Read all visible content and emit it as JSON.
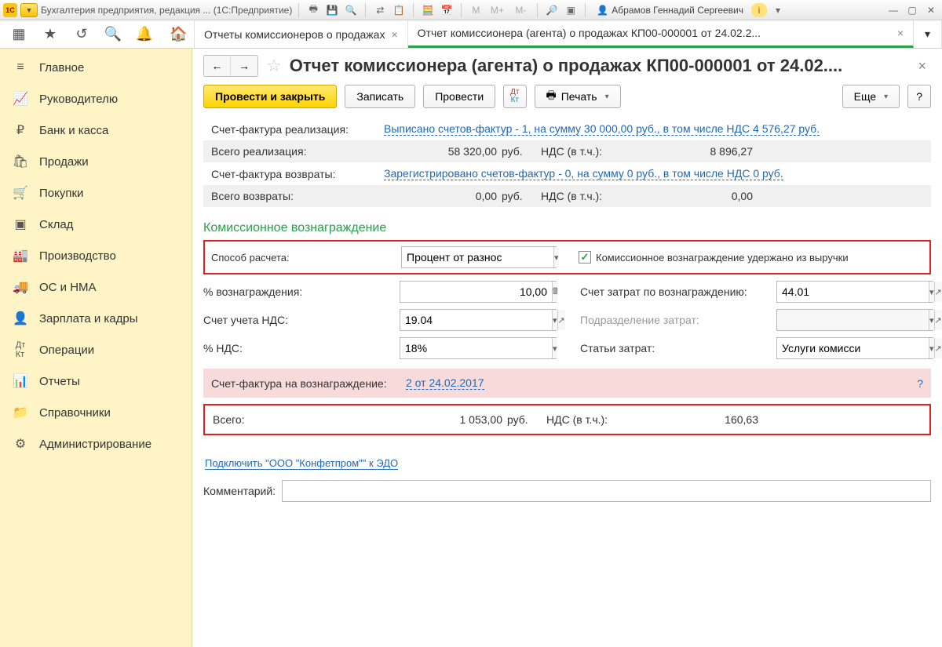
{
  "titlebar": {
    "app_title": "Бухгалтерия предприятия, редакция ... (1С:Предприятие)",
    "user": "Абрамов Геннадий Сергеевич",
    "m_lbl": "M",
    "mplus_lbl": "M+",
    "mminus_lbl": "M-"
  },
  "tabs": {
    "list_tab": "Отчеты комиссионеров о продажах",
    "doc_tab": "Отчет комиссионера (агента) о продажах КП00-000001 от 24.02.2..."
  },
  "sidebar": {
    "items": [
      "Главное",
      "Руководителю",
      "Банк и касса",
      "Продажи",
      "Покупки",
      "Склад",
      "Производство",
      "ОС и НМА",
      "Зарплата и кадры",
      "Операции",
      "Отчеты",
      "Справочники",
      "Администрирование"
    ]
  },
  "doc": {
    "title": "Отчет комиссионера (агента) о продажах КП00-000001 от 24.02....",
    "btn_post_close": "Провести и закрыть",
    "btn_write": "Записать",
    "btn_post": "Провести",
    "btn_print": "Печать",
    "btn_more": "Еще",
    "btn_help": "?"
  },
  "summary": {
    "sf_real_lbl": "Счет-фактура реализация:",
    "sf_real_link": "Выписано счетов-фактур - 1, на сумму 30 000,00 руб., в том числе НДС 4 576,27 руб.",
    "total_real_lbl": "Всего реализация:",
    "total_real_amt": "58 320,00",
    "cur": "руб.",
    "vat_lbl": "НДС (в т.ч.):",
    "total_real_vat": "8 896,27",
    "sf_ret_lbl": "Счет-фактура возвраты:",
    "sf_ret_link": "Зарегистрировано счетов-фактур - 0, на сумму 0 руб., в том числе НДС 0 руб.",
    "total_ret_lbl": "Всего возвраты:",
    "total_ret_amt": "0,00",
    "total_ret_vat": "0,00"
  },
  "commission": {
    "section_title": "Комиссионное вознаграждение",
    "calc_method_lbl": "Способ расчета:",
    "calc_method_val": "Процент от разнос",
    "withheld_chk_lbl": "Комиссионное вознаграждение удержано из выручки",
    "pct_lbl": "% вознаграждения:",
    "pct_val": "10,00",
    "expense_acct_lbl": "Счет затрат по вознаграждению:",
    "expense_acct_val": "44.01",
    "vat_acct_lbl": "Счет учета НДС:",
    "vat_acct_val": "19.04",
    "subdiv_lbl": "Подразделение затрат:",
    "subdiv_val": "",
    "vat_pct_lbl": "% НДС:",
    "vat_pct_val": "18%",
    "cost_item_lbl": "Статьи затрат:",
    "cost_item_val": "Услуги комисси",
    "sf_comm_lbl": "Счет-фактура на вознаграждение:",
    "sf_comm_link": "2 от 24.02.2017",
    "total_lbl": "Всего:",
    "total_amt": "1 053,00",
    "total_vat": "160,63"
  },
  "footer": {
    "edo_link": "Подключить \"ООО \"Конфетпром\"\" к ЭДО",
    "comment_lbl": "Комментарий:",
    "comment_val": ""
  }
}
